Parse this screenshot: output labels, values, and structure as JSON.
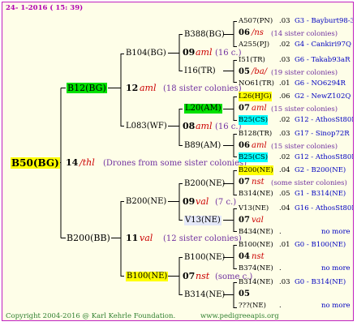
{
  "header": {
    "date_label": "24-  1-2016 ( 15: 39)"
  },
  "footer": {
    "copyright": "Copyright 2004-2016 @ Karl Kehrle Foundation.",
    "site": "www.pedigreeapis.org"
  },
  "root": {
    "label": "B50(BG)",
    "gen_num": "14",
    "gen_code": "/thl",
    "note": "(Drones from some sister colonies)",
    "mother": {
      "label": "B12(BG)",
      "gen_num": "12",
      "gen_code": "aml",
      "note": "(18 sister colonies)",
      "mother": {
        "label": "B104(BG)",
        "mother": {
          "label": "B388(BG)",
          "gen_num": "09",
          "gen_code": "aml",
          "note": "(16 c.)",
          "rows": [
            {
              "label": "A507(PN)",
              "num": ".03",
              "code": "G3 - Bayburt98-3"
            },
            {
              "num": "06",
              "italic": "/ns",
              "note": "(14 sister colonies)"
            },
            {
              "label": "A255(PJ)",
              "num": ".02",
              "code": "G4 - Cankiri97Q"
            }
          ]
        },
        "father": {
          "label": "I16(TR)",
          "rows": [
            {
              "label": "I51(TR)",
              "num": ".03",
              "code": "G6 - Takab93aR"
            },
            {
              "num": "05",
              "italic": "/ba/",
              "note": "(19 sister colonies)"
            },
            {
              "label": "NO61(TR)",
              "num": ".01",
              "code": "G6 - NO6294R"
            }
          ]
        }
      },
      "father": {
        "label": "L083(WF)",
        "gen_num": "08",
        "gen_code": "aml",
        "note": "(16 c.)",
        "mother": {
          "label": "L20(AM)",
          "gen_num": "07",
          "gen_code": "aml",
          "rows": [
            {
              "label": "L26(HJG)",
              "num": ".06",
              "code": "G2 - NewZ102Q"
            },
            {
              "num": "07",
              "italic": "aml",
              "note": "(15 sister colonies)"
            },
            {
              "label": "B25(CS)",
              "num": ".02",
              "code": "G12 - AthosSt80R"
            }
          ]
        },
        "father": {
          "label": "B89(AM)",
          "rows": [
            {
              "label": "B128(TR)",
              "num": ".03",
              "code": "G17 - Sinop72R"
            },
            {
              "num": "06",
              "italic": "aml",
              "note": "(15 sister colonies)"
            },
            {
              "label": "B25(CS)",
              "num": ".02",
              "code": "G12 - AthosSt80R"
            }
          ]
        }
      }
    },
    "father": {
      "label": "B200(BB)",
      "gen_num": "11",
      "gen_code": "val",
      "note": "(12 sister colonies)",
      "mother": {
        "label": "B200(NE)",
        "gen_num": "09",
        "gen_code": "val",
        "note": "(7 c.)",
        "mother": {
          "label": "B200(NE)",
          "rows": [
            {
              "label": "B200(NE)",
              "num": ".04",
              "code": "G2 - B200(NE)"
            },
            {
              "num": "07",
              "italic": "nst",
              "note": "(some sister colonies)"
            },
            {
              "label": "B314(NE)",
              "num": ".05",
              "code": "G1 - B314(NE)"
            }
          ]
        },
        "father": {
          "label": "V13(NE)",
          "rows": [
            {
              "label": "V13(NE)",
              "num": ".04",
              "code": "G16 - AthosSt80R"
            },
            {
              "num": "07",
              "italic": "val",
              "note": ""
            },
            {
              "label": "B434(NE)",
              "num": ".",
              "code": "no more"
            }
          ]
        }
      },
      "father": {
        "label": "B100(NE)",
        "gen_num": "07",
        "gen_code": "nst",
        "note": "(some c.)",
        "mother": {
          "label": "B100(NE)",
          "rows": [
            {
              "label": "B100(NE)",
              "num": ".01",
              "code": "G0 - B100(NE)"
            },
            {
              "num": "04",
              "italic": "nst",
              "note": ""
            },
            {
              "label": "B374(NE)",
              "num": ".",
              "code": "no more"
            }
          ]
        },
        "father": {
          "label": "B314(NE)",
          "rows": [
            {
              "label": "B314(NE)",
              "num": ".03",
              "code": "G0 - B314(NE)"
            },
            {
              "num": "05",
              "italic": "",
              "note": ""
            },
            {
              "label": "???(NE)",
              "num": ".",
              "code": "no more"
            }
          ]
        }
      }
    }
  },
  "colors": {
    "border": "#c020c0",
    "background": "#fefee8",
    "lines": "#000000",
    "highlight_green": "#00e000",
    "highlight_yellow": "#ffff00",
    "highlight_cyan": "#00ffff",
    "code_blue": "#0000c0",
    "note_purple": "#7030a0",
    "gene_red": "#cc0000"
  }
}
